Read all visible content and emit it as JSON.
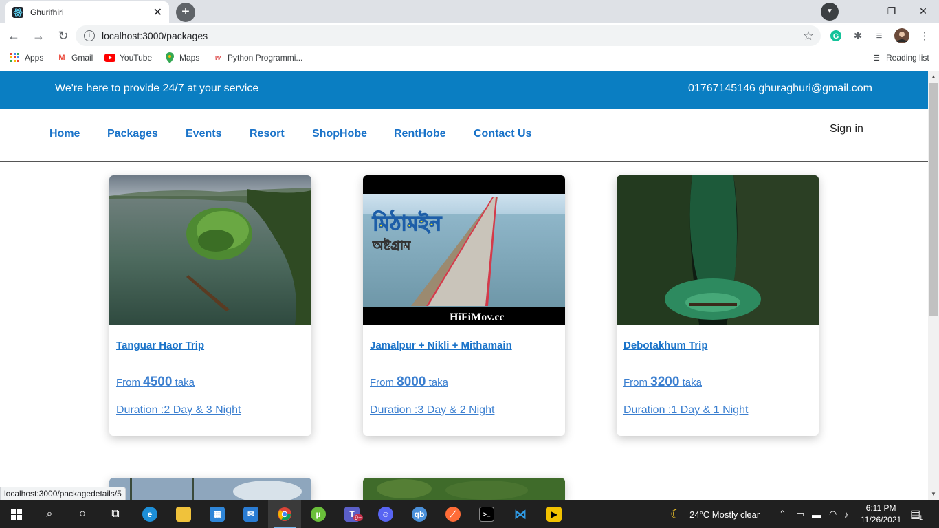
{
  "browser": {
    "tab_title": "Ghurifhiri",
    "url": "localhost:3000/packages",
    "bookmarks": [
      "Apps",
      "Gmail",
      "YouTube",
      "Maps",
      "Python Programmi..."
    ],
    "reading_list": "Reading list",
    "status_url": "localhost:3000/packagedetails/5"
  },
  "site": {
    "topbar_left": "We're here to provide 24/7 at your service",
    "topbar_right": "01767145146 ghuraghuri@gmail.com",
    "nav": [
      "Home",
      "Packages",
      "Events",
      "Resort",
      "ShopHobe",
      "RentHobe",
      "Contact Us"
    ],
    "signin": "Sign in",
    "price_prefix": "From",
    "price_suffix": "taka",
    "packages": [
      {
        "title": "Tanguar Haor Trip",
        "price": "4500",
        "duration": "Duration :2 Day & 3 Night"
      },
      {
        "title": "Jamalpur + Nikli + Mithamain",
        "price": "8000",
        "duration": "Duration :3 Day & 2 Night",
        "image_text": [
          "মিঠামইন",
          "অষ্টগ্রাম",
          "HiFiMov.cc"
        ]
      },
      {
        "title": "Debotakhum Trip",
        "price": "3200",
        "duration": "Duration :1 Day & 1 Night"
      }
    ]
  },
  "taskbar": {
    "weather": "24°C  Mostly clear",
    "time": "6:11 PM",
    "date": "11/26/2021",
    "teams_badge": "9+",
    "notification_count": "1"
  },
  "colors": {
    "topbar": "#0a7ec2",
    "link": "#1a73c9",
    "taskbar": "#202020"
  }
}
